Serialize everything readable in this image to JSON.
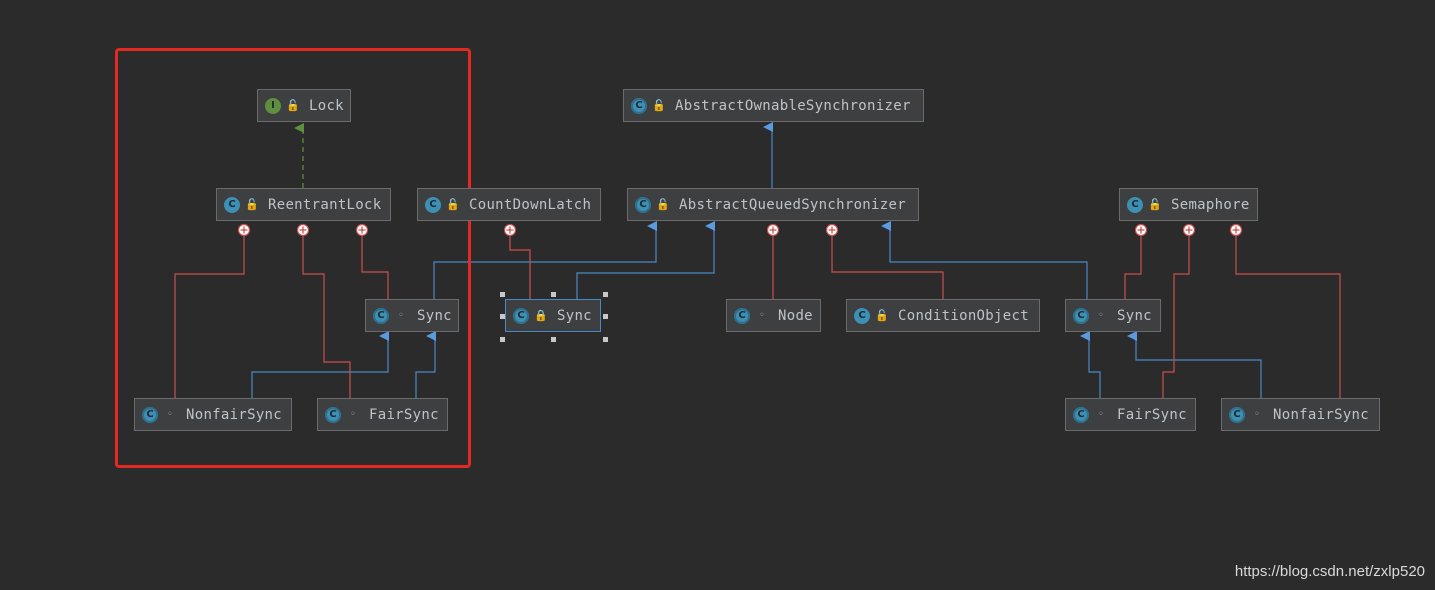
{
  "diagram": {
    "nodes": {
      "lock": {
        "name": "Lock",
        "kind": "I"
      },
      "reentrant_lock": {
        "name": "ReentrantLock",
        "kind": "C"
      },
      "rl_sync": {
        "name": "Sync",
        "kind": "C"
      },
      "rl_nonfair_sync": {
        "name": "NonfairSync",
        "kind": "C"
      },
      "rl_fair_sync": {
        "name": "FairSync",
        "kind": "C"
      },
      "count_down_latch": {
        "name": "CountDownLatch",
        "kind": "C"
      },
      "cdl_sync": {
        "name": "Sync",
        "kind": "C"
      },
      "aos": {
        "name": "AbstractOwnableSynchronizer",
        "kind": "C"
      },
      "aqs": {
        "name": "AbstractQueuedSynchronizer",
        "kind": "C"
      },
      "node": {
        "name": "Node",
        "kind": "C"
      },
      "condition_object": {
        "name": "ConditionObject",
        "kind": "C"
      },
      "semaphore": {
        "name": "Semaphore",
        "kind": "C"
      },
      "sem_sync": {
        "name": "Sync",
        "kind": "C"
      },
      "sem_fair_sync": {
        "name": "FairSync",
        "kind": "C"
      },
      "sem_nonfair_sync": {
        "name": "NonfairSync",
        "kind": "C"
      }
    }
  },
  "colors": {
    "background": "#2b2b2b",
    "node_fill": "#3d3f41",
    "extends_edge": "#4a88c7",
    "implements_edge": "#5f8f3e",
    "inner_class_edge": "#c9504d",
    "highlight": "#e22a22"
  },
  "watermark": "https://blog.csdn.net/zxlp520"
}
